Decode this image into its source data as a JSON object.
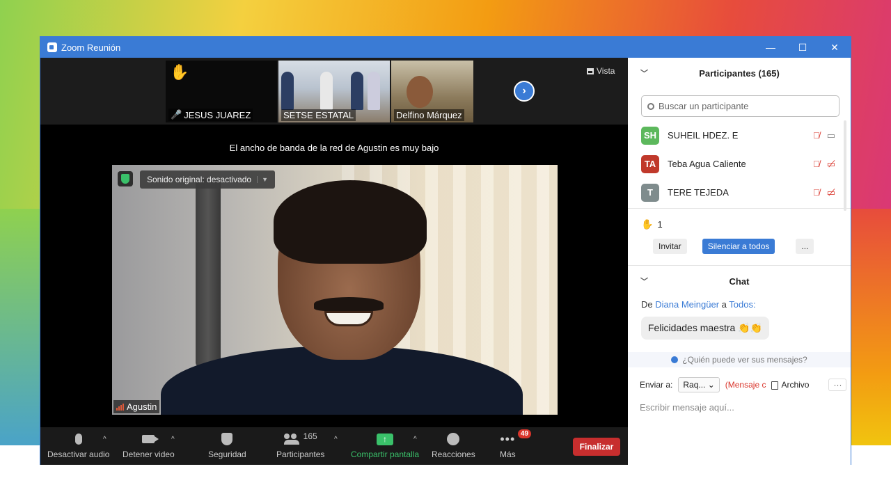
{
  "window": {
    "title": "Zoom Reunión",
    "controls": {
      "minimize": "—",
      "maximize": "☐",
      "close": "✕"
    }
  },
  "thumbnails": [
    {
      "name": "JESUS JUAREZ",
      "muted": true,
      "hand_raised": true
    },
    {
      "name": "SETSE ESTATAL",
      "muted": false
    },
    {
      "name": "Delfino Márquez",
      "muted": false
    }
  ],
  "view_button": {
    "label": "Vista"
  },
  "bandwidth_notice": "El ancho de banda de la red de Agustin es muy bajo",
  "main_video": {
    "audio_pill": "Sonido original: desactivado",
    "speaker_name": "Agustin"
  },
  "toolbar": {
    "audio_label": "Desactivar audio",
    "video_label": "Detener video",
    "security_label": "Seguridad",
    "participants_label": "Participantes",
    "participants_count": "165",
    "share_label": "Compartir pantalla",
    "reactions_label": "Reacciones",
    "more_label": "Más",
    "more_badge": "49",
    "end_label": "Finalizar",
    "end_color": "#c72e2e",
    "share_color": "#3ac16a"
  },
  "participants_panel": {
    "title": "Participantes (165)",
    "search_placeholder": "Buscar un participante",
    "list": [
      {
        "initials": "SH",
        "name": "SUHEIL HDEZ. E",
        "color": "#5cb85c"
      },
      {
        "initials": "TA",
        "name": "Teba Agua Caliente",
        "color": "#c0392b"
      },
      {
        "initials": "T",
        "name": "TERE TEJEDA",
        "color": "#7f8c8d"
      }
    ],
    "raised_hands": "1",
    "invite_label": "Invitar",
    "mute_all_label": "Silenciar a todos",
    "more_label": "..."
  },
  "chat_panel": {
    "title": "Chat",
    "from_prefix": "De",
    "from_name": "Diana Meingüer",
    "to_word": "a",
    "to_name": "Todos:",
    "message": "Felicidades maestra 👏👏",
    "who_sees": "¿Quién puede ver sus mensajes?",
    "send_to_label": "Enviar a:",
    "send_to_value": "Raq...",
    "private_label": "(Mensaje c",
    "file_label": "Archivo",
    "input_placeholder": "Escribir mensaje aquí..."
  },
  "accent_color": "#3a7bd5"
}
